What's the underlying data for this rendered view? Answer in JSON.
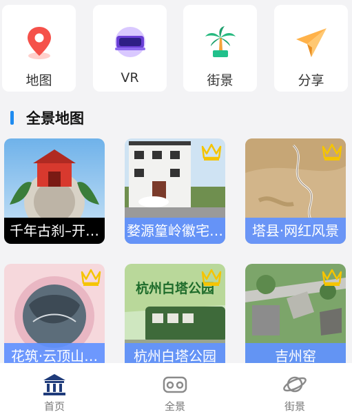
{
  "shortcuts": [
    {
      "label": "地图",
      "icon": "map-pin-icon"
    },
    {
      "label": "VR",
      "icon": "vr-headset-icon"
    },
    {
      "label": "街景",
      "icon": "palm-tree-icon"
    },
    {
      "label": "分享",
      "icon": "paper-plane-icon"
    }
  ],
  "section": {
    "title": "全景地图"
  },
  "panoramas": [
    {
      "title": "千年古刹–开…",
      "premium": false
    },
    {
      "title": "婺源篁岭徽宅…",
      "premium": true
    },
    {
      "title": "塔县·网红风景",
      "premium": true
    },
    {
      "title": "花筑·云顶山…",
      "premium": true
    },
    {
      "title": "杭州白塔公园",
      "premium": true,
      "sign_text": "杭州白塔公园"
    },
    {
      "title": "吉州窑",
      "premium": true
    }
  ],
  "nav": [
    {
      "label": "首页",
      "icon": "bank-building-icon"
    },
    {
      "label": "全景",
      "icon": "vr-glasses-icon"
    },
    {
      "label": "街景",
      "icon": "planet-icon"
    }
  ],
  "colors": {
    "accent": "#1f8bf0",
    "caption_blue": "#6192ff",
    "premium_crown": "#f5c400"
  }
}
